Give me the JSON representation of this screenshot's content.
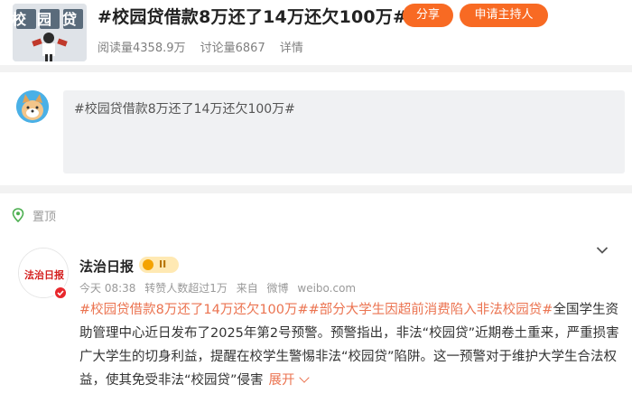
{
  "topic": {
    "title": "#校园贷借款8万还了14万还欠100万#",
    "reads": "阅读量4358.9万",
    "discussions": "讨论量6867",
    "details": "详情",
    "share_label": "分享",
    "host_label": "申请主持人",
    "thumb_label": "校园贷"
  },
  "compose": {
    "text": "#校园贷借款8万还了14万还欠100万#"
  },
  "pinned": {
    "label": "置顶"
  },
  "post": {
    "author": "法治日报",
    "badge_text": "II",
    "time": "今天 08:38",
    "reposts": "转赞人数超过1万",
    "source_prefix": "来自",
    "source": "微博",
    "source_url": "weibo.com",
    "tag1": "#校园贷借款8万还了14万还欠100万#",
    "tag2": "#部分大学生因超前消费陷入非法校园贷#",
    "body": "全国学生资助管理中心近日发布了2025年第2号预警。预警指出，非法“校园贷”近期卷土重来，严重损害广大学生的切身利益，提醒在校学生警惕非法“校园贷”陷阱。这一预警对于维护大学生合法权益，使其免受非法“校园贷”侵害",
    "more": "展开",
    "avatar_text": "法治日报"
  },
  "colors": {
    "accent": "#f86a23",
    "tag": "#eb7350"
  }
}
